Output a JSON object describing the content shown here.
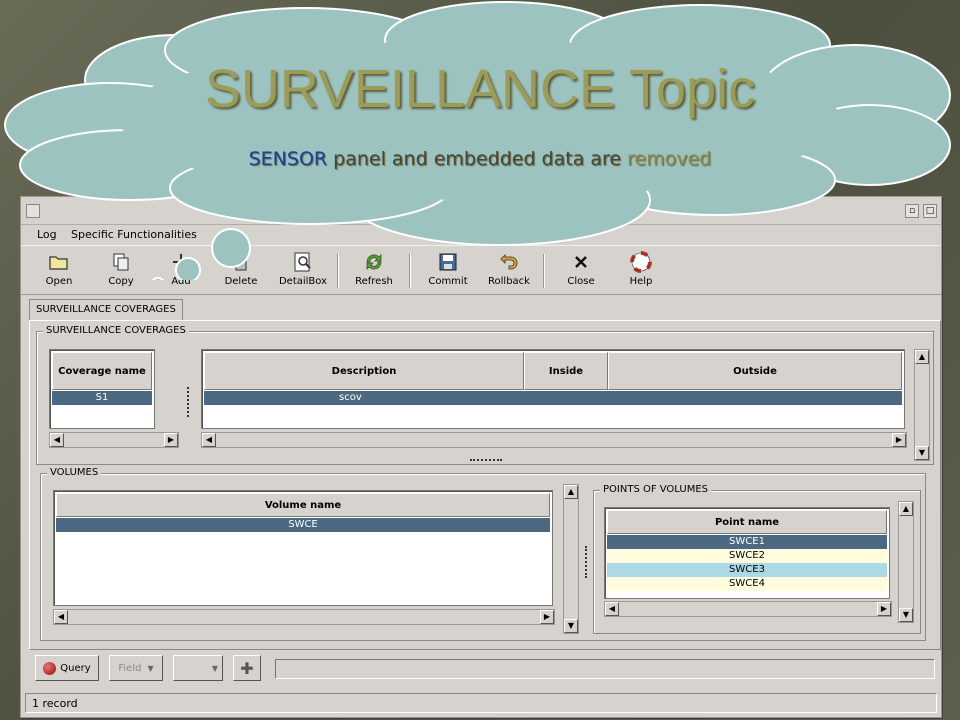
{
  "callout": {
    "title": "SURVEILLANCE Topic",
    "subtitle_keyword": "SENSOR",
    "subtitle_text": " panel and embedded data are ",
    "subtitle_removed": "removed"
  },
  "window": {
    "title_buttons": {
      "minimize": "▫",
      "maximize": "□"
    }
  },
  "menu": {
    "items": [
      {
        "label": "Log"
      },
      {
        "label": "Specific Functionalities"
      }
    ]
  },
  "toolbar": {
    "buttons": [
      {
        "label": "Open",
        "icon": "folder-icon"
      },
      {
        "label": "Copy",
        "icon": "copy-icon"
      },
      {
        "label": "Add",
        "icon": "add-icon"
      },
      {
        "label": "Delete",
        "icon": "trash-icon"
      },
      {
        "label": "DetailBox",
        "icon": "magnifier-icon"
      },
      {
        "label": "Refresh",
        "icon": "refresh-icon"
      },
      {
        "label": "Commit",
        "icon": "disk-icon"
      },
      {
        "label": "Rollback",
        "icon": "undo-icon"
      },
      {
        "label": "Close",
        "icon": "close-icon"
      },
      {
        "label": "Help",
        "icon": "lifebuoy-icon"
      }
    ]
  },
  "tabs": [
    {
      "label": "SURVEILLANCE COVERAGES"
    }
  ],
  "coverages": {
    "legend": "SURVEILLANCE COVERAGES",
    "left_table": {
      "header": "Coverage name",
      "rows": [
        "S1"
      ]
    },
    "right_table": {
      "headers": [
        "Description",
        "Inside",
        "Outside"
      ],
      "rows": [
        [
          "scov",
          "",
          ""
        ]
      ]
    }
  },
  "volumes": {
    "legend": "VOLUMES",
    "header": "Volume name",
    "rows": [
      "SWCE"
    ]
  },
  "points": {
    "legend": "POINTS OF VOLUMES",
    "header": "Point name",
    "rows": [
      "SWCE1",
      "SWCE2",
      "SWCE3",
      "SWCE4"
    ]
  },
  "bottom": {
    "query_label": "Query",
    "field_label": "Field"
  },
  "status": {
    "text": "1 record"
  },
  "colors": {
    "selection": "#4b6983",
    "cloud_fill": "#9dc3c1",
    "cloud_stroke": "#ffffff",
    "title_color": "#9c9c5a",
    "keyword_color": "#1b3fa0"
  }
}
